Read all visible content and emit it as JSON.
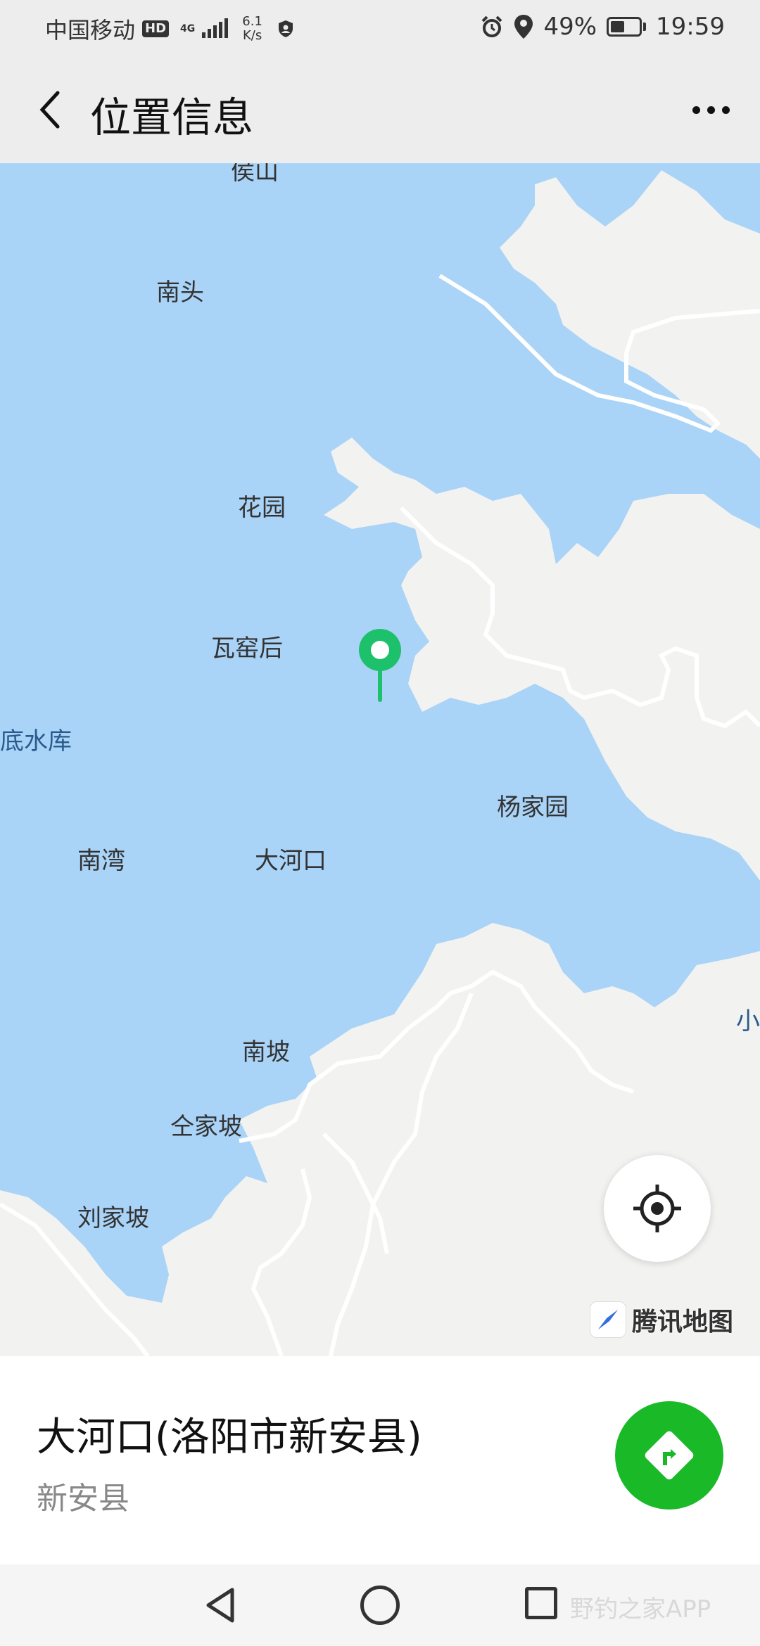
{
  "status_bar": {
    "carrier": "中国移动",
    "hd": "HD",
    "network": "4G",
    "speed_value": "6.1",
    "speed_unit": "K/s",
    "battery_percent": "49%",
    "battery_level": 0.49,
    "time": "19:59"
  },
  "header": {
    "title": "位置信息",
    "back_icon": "chevron-left-icon",
    "more_icon": "more-dots-icon"
  },
  "map": {
    "labels": {
      "top_cut": "侯山",
      "nantou": "南头",
      "huayuan": "花园",
      "wayaohou": "瓦窑后",
      "reservoir": "陈底水库",
      "yangjiayuan": "杨家园",
      "nanwan": "南湾",
      "daheokou": "大河口",
      "xiao": "小",
      "nanpo": "南坡",
      "quanjiapo": "仝家坡",
      "liujiapo": "刘家坡"
    },
    "provider": "腾讯地图",
    "colors": {
      "water": "#a9d3f7",
      "land": "#f2f2f0",
      "road": "#ffffff",
      "pin": "#1ec16b"
    }
  },
  "location": {
    "name": "大河口(洛阳市新安县)",
    "sub": "新安县",
    "nav_color": "#19b928"
  },
  "system_nav": {
    "watermark": "野钓之家APP"
  }
}
